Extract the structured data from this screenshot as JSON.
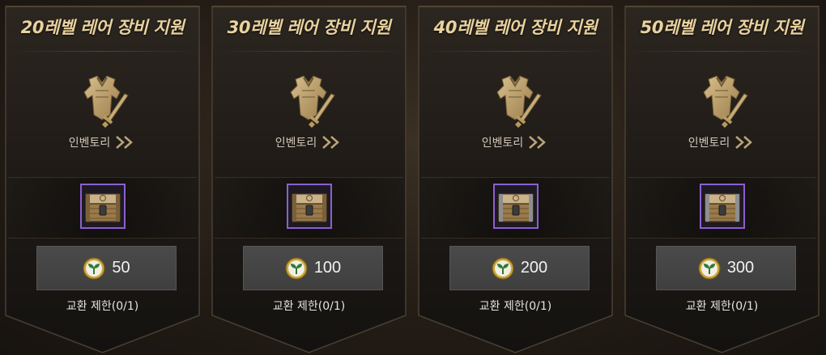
{
  "cards": [
    {
      "title": "20레벨 레어 장비 지원",
      "inventory_label": "인벤토리",
      "item_icon": "wooden-chest-icon",
      "price": "50",
      "currency_icon": "sprout-coin-icon",
      "limit": "교환 제한(0/1)"
    },
    {
      "title": "30레벨 레어 장비 지원",
      "inventory_label": "인벤토리",
      "item_icon": "wooden-chest-icon",
      "price": "100",
      "currency_icon": "sprout-coin-icon",
      "limit": "교환 제한(0/1)"
    },
    {
      "title": "40레벨 레어 장비 지원",
      "inventory_label": "인벤토리",
      "item_icon": "iron-banded-chest-icon",
      "price": "200",
      "currency_icon": "sprout-coin-icon",
      "limit": "교환 제한(0/1)"
    },
    {
      "title": "50레벨 레어 장비 지원",
      "inventory_label": "인벤토리",
      "item_icon": "iron-banded-chest-icon",
      "price": "300",
      "currency_icon": "sprout-coin-icon",
      "limit": "교환 제한(0/1)"
    }
  ],
  "colors": {
    "title": "#e9d29e",
    "item_border_rare": "#8c5fd0",
    "coin_gold": "#c9a43c",
    "coin_green": "#2f7a3a"
  }
}
